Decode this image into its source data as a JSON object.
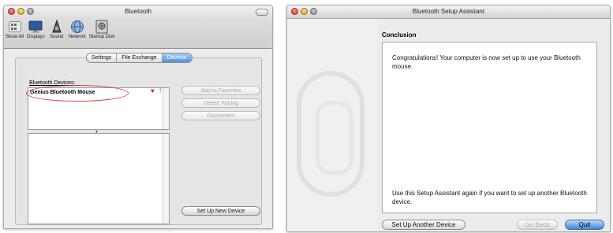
{
  "left_window": {
    "title": "Bluetooth",
    "toolbar": [
      {
        "label": "Show All",
        "icon": "show-all-grid-icon"
      },
      {
        "label": "Displays",
        "icon": "display-icon"
      },
      {
        "label": "Sound",
        "icon": "speaker-icon"
      },
      {
        "label": "Network",
        "icon": "globe-icon"
      },
      {
        "label": "Startup Disk",
        "icon": "disk-icon"
      }
    ],
    "tabs": [
      "Settings",
      "File Exchange",
      "Devices"
    ],
    "active_tab": "Devices",
    "devices_label": "Bluetooth Devices:",
    "devices": [
      {
        "name": "Genius Bluetooth Mouse"
      }
    ],
    "buttons": {
      "add_favorites": "Add to Favorites",
      "delete_pairing": "Delete Pairing",
      "disconnect": "Disconnect",
      "setup_new": "Set Up New Device"
    }
  },
  "right_window": {
    "title": "Bluetooth Setup Assistant",
    "section_title": "Conclusion",
    "message": "Congratulations! Your computer is now set up to use your Bluetooth mouse.",
    "footer_message": "Use this Setup Assistant again if you want to set up another Bluetooth device.",
    "buttons": {
      "setup_another": "Set Up Another Device",
      "go_back": "Go Back",
      "quit": "Quit"
    }
  },
  "colors": {
    "accent_blue": "#4f90db",
    "highlight_red": "#d43a3a"
  }
}
